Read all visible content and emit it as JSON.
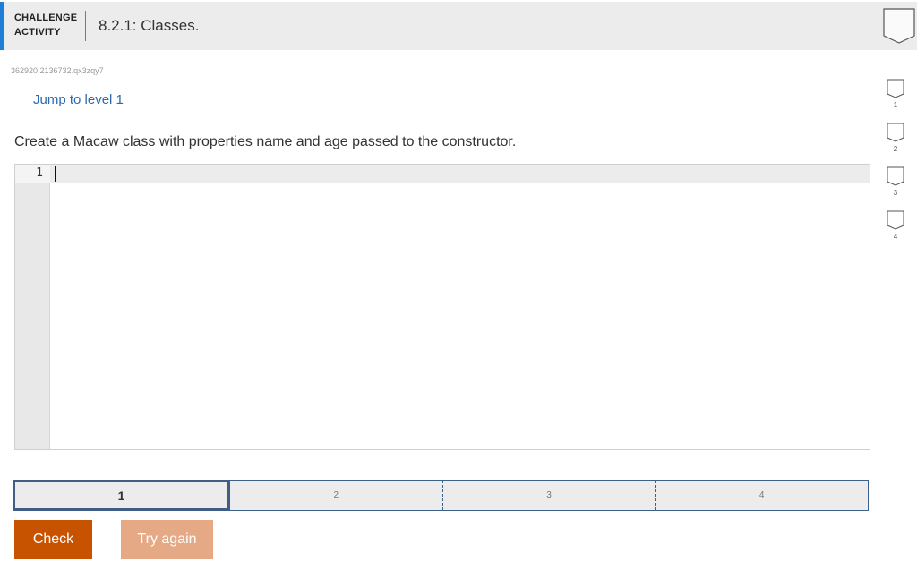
{
  "header": {
    "tag_line1": "CHALLENGE",
    "tag_line2": "ACTIVITY",
    "title": "8.2.1: Classes."
  },
  "activity_id": "362920.2136732.qx3zqy7",
  "jump_link": "Jump to level 1",
  "instruction": "Create a Macaw class with properties name and age passed to the constructor.",
  "editor": {
    "line_numbers": [
      "1"
    ],
    "content": ""
  },
  "levels": [
    "1",
    "2",
    "3",
    "4"
  ],
  "current_level": "1",
  "buttons": {
    "check": "Check",
    "try_again": "Try again"
  },
  "side_levels": [
    "1",
    "2",
    "3",
    "4"
  ],
  "colors": {
    "accent_blue": "#1f7fd6",
    "check_button": "#c75300",
    "try_again_button": "#e5a985",
    "level_border": "#3a6289"
  }
}
